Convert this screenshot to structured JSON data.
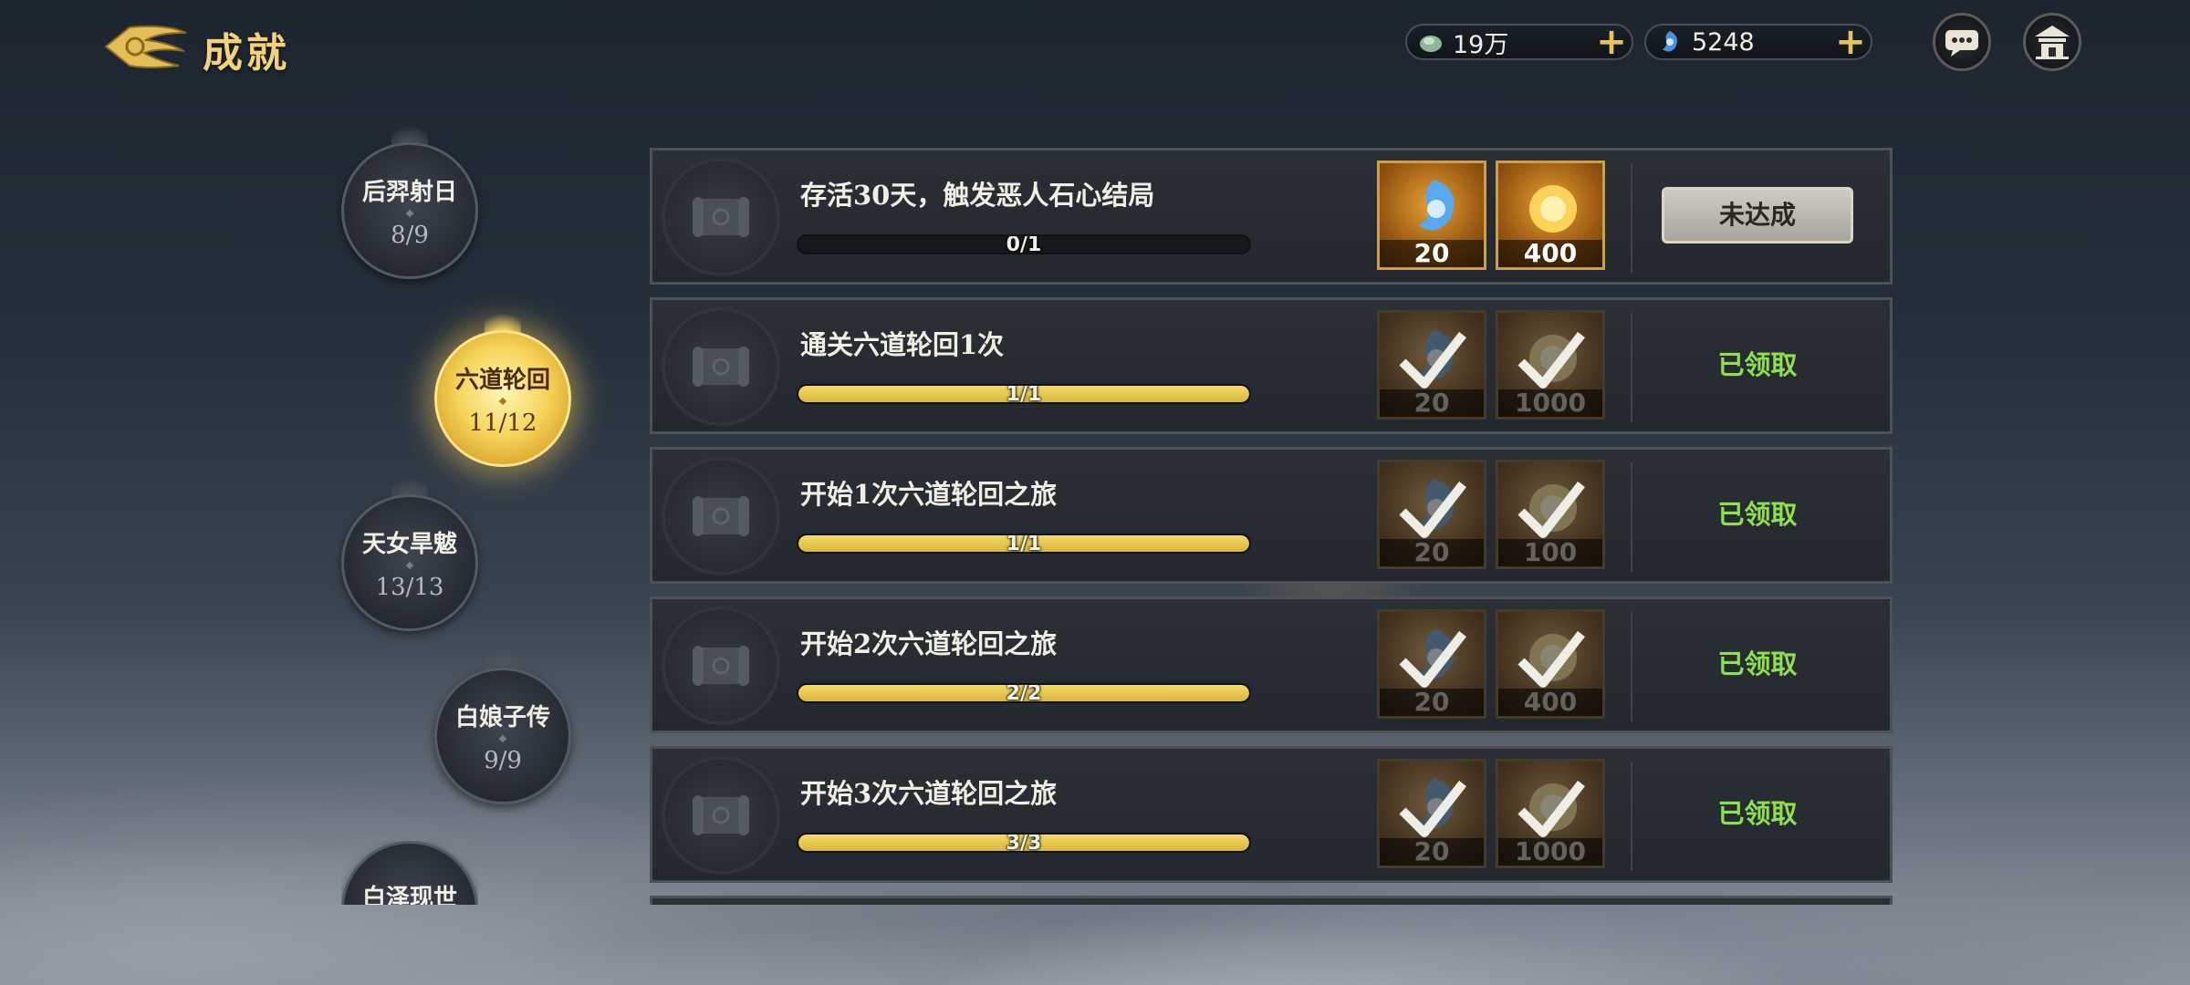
{
  "header": {
    "title": "成就",
    "currencies": [
      {
        "icon": "jade-currency-icon",
        "value": "19万"
      },
      {
        "icon": "spirit-gem-icon",
        "value": "5248"
      }
    ]
  },
  "categories": [
    {
      "name": "后羿射日",
      "count": "8/9",
      "active": false
    },
    {
      "name": "六道轮回",
      "count": "11/12",
      "active": true
    },
    {
      "name": "天女旱魃",
      "count": "13/13",
      "active": false
    },
    {
      "name": "白娘子传",
      "count": "9/9",
      "active": false
    },
    {
      "name": "白泽现世",
      "count": "",
      "active": false
    }
  ],
  "achievements": [
    {
      "title": "存活30天，触发恶人石心结局",
      "progress_text": "0/1",
      "progress": 0,
      "rewards": [
        {
          "icon": "spirit-gem-icon",
          "qty": "20"
        },
        {
          "icon": "gold-coin-icon",
          "qty": "400"
        }
      ],
      "status": "未达成",
      "claimed": false
    },
    {
      "title": "通关六道轮回1次",
      "progress_text": "1/1",
      "progress": 1,
      "rewards": [
        {
          "icon": "spirit-gem-icon",
          "qty": "20"
        },
        {
          "icon": "gold-coin-icon",
          "qty": "1000"
        }
      ],
      "status": "已领取",
      "claimed": true
    },
    {
      "title": "开始1次六道轮回之旅",
      "progress_text": "1/1",
      "progress": 1,
      "rewards": [
        {
          "icon": "spirit-gem-icon",
          "qty": "20"
        },
        {
          "icon": "gold-coin-icon",
          "qty": "100"
        }
      ],
      "status": "已领取",
      "claimed": true
    },
    {
      "title": "开始2次六道轮回之旅",
      "progress_text": "2/2",
      "progress": 1,
      "rewards": [
        {
          "icon": "spirit-gem-icon",
          "qty": "20"
        },
        {
          "icon": "gold-coin-icon",
          "qty": "400"
        }
      ],
      "status": "已领取",
      "claimed": true
    },
    {
      "title": "开始3次六道轮回之旅",
      "progress_text": "3/3",
      "progress": 1,
      "rewards": [
        {
          "icon": "spirit-gem-icon",
          "qty": "20"
        },
        {
          "icon": "gold-coin-icon",
          "qty": "1000"
        }
      ],
      "status": "已领取",
      "claimed": true
    }
  ],
  "colors": {
    "accent_gold": "#f3d27a",
    "claimed_green": "#8fe04a",
    "progress_gold": "#e6c64d"
  }
}
